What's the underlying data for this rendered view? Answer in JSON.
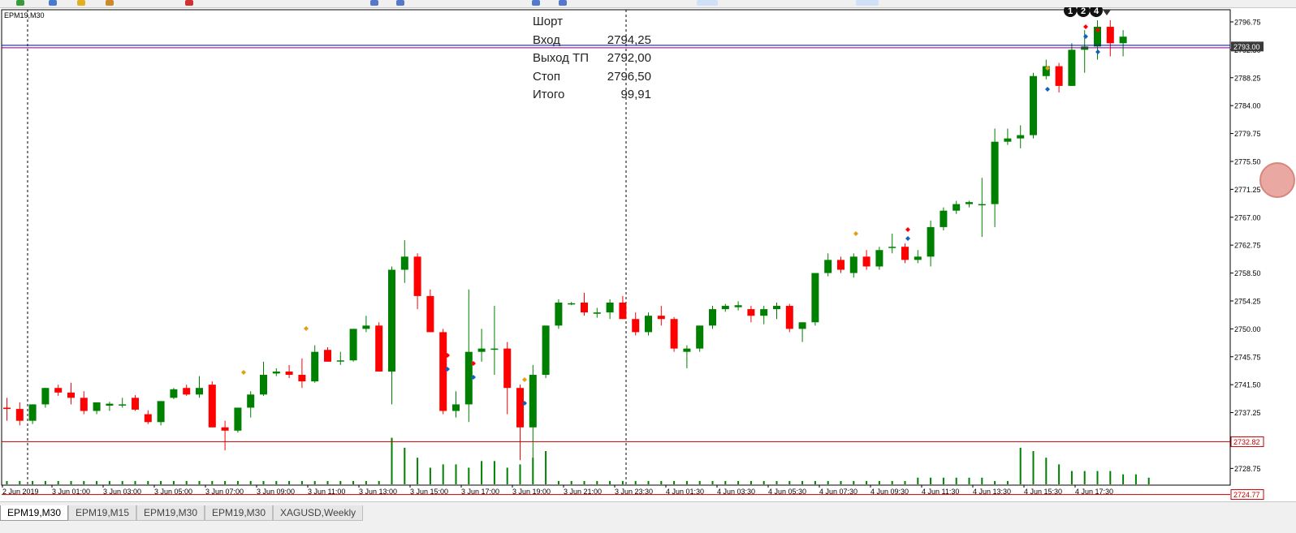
{
  "symbol_label": "EPM19,M30",
  "trade_info": {
    "rows": [
      {
        "label": "Шорт",
        "value": ""
      },
      {
        "label": "Вход",
        "value": "2794,25"
      },
      {
        "label": "Выход ТП",
        "value": "2792,00"
      },
      {
        "label": "Стоп",
        "value": "2796,50"
      },
      {
        "label": "Итого",
        "value": "99,91"
      }
    ]
  },
  "markers": [
    "1",
    "2",
    "4"
  ],
  "tabs": [
    {
      "label": "EPM19,M30",
      "active": true
    },
    {
      "label": "EPM19,M15",
      "active": false
    },
    {
      "label": "EPM19,M30",
      "active": false
    },
    {
      "label": "EPM19,M30",
      "active": false
    },
    {
      "label": "XAGUSD,Weekly",
      "active": false
    }
  ],
  "colors": {
    "bull": "#008000",
    "bear": "#ff0000",
    "grid_line": "#c00000",
    "price_line": "#0000c0",
    "price_line2": "#800080"
  },
  "chart_data": {
    "type": "candlestick",
    "ylim": [
      2726.2,
      2798.6
    ],
    "y_ticks": [
      "2796.75",
      "2792.50",
      "2788.25",
      "2784.00",
      "2779.75",
      "2775.50",
      "2771.25",
      "2767.00",
      "2762.75",
      "2758.50",
      "2754.25",
      "2750.00",
      "2745.75",
      "2741.50",
      "2737.25",
      "2733.00",
      "2728.75",
      "2724.50"
    ],
    "x_tick_labels": [
      "2 Jun 2019",
      "3 Jun 01:00",
      "3 Jun 03:00",
      "3 Jun 05:00",
      "3 Jun 07:00",
      "3 Jun 09:00",
      "3 Jun 11:00",
      "3 Jun 13:00",
      "3 Jun 15:00",
      "3 Jun 17:00",
      "3 Jun 19:00",
      "3 Jun 21:00",
      "3 Jun 23:30",
      "4 Jun 01:30",
      "4 Jun 03:30",
      "4 Jun 05:30",
      "4 Jun 07:30",
      "4 Jun 09:30",
      "4 Jun 11:30",
      "4 Jun 13:30",
      "4 Jun 15:30",
      "4 Jun 17:30"
    ],
    "price_tags": [
      {
        "price": 2793.0,
        "label": "2793.00",
        "kind": "current"
      },
      {
        "price": 2732.82,
        "label": "2732.82",
        "kind": "level"
      },
      {
        "price": 2724.77,
        "label": "2724.77",
        "kind": "level"
      }
    ],
    "candles": [
      [
        2738.0,
        2739.5,
        2736.0,
        2737.8
      ],
      [
        2737.8,
        2738.8,
        2735.3,
        2736.0
      ],
      [
        2736.0,
        2738.5,
        2735.5,
        2738.5
      ],
      [
        2738.5,
        2741.0,
        2738.0,
        2741.0
      ],
      [
        2741.0,
        2741.5,
        2739.8,
        2740.3
      ],
      [
        2740.3,
        2741.8,
        2738.5,
        2739.5
      ],
      [
        2739.5,
        2740.5,
        2737.0,
        2737.5
      ],
      [
        2737.5,
        2738.8,
        2737.0,
        2738.8
      ],
      [
        2738.3,
        2738.9,
        2737.5,
        2738.6
      ],
      [
        2738.5,
        2739.5,
        2738.0,
        2738.5
      ],
      [
        2739.5,
        2739.9,
        2737.5,
        2737.7
      ],
      [
        2737.0,
        2737.6,
        2735.5,
        2735.8
      ],
      [
        2735.8,
        2739.0,
        2735.3,
        2739.0
      ],
      [
        2739.5,
        2741.0,
        2739.3,
        2740.8
      ],
      [
        2741.0,
        2741.5,
        2739.8,
        2740.0
      ],
      [
        2740.0,
        2742.8,
        2739.5,
        2741.0
      ],
      [
        2741.5,
        2742.0,
        2735.0,
        2735.0
      ],
      [
        2735.0,
        2736.0,
        2731.5,
        2734.5
      ],
      [
        2734.5,
        2738.0,
        2734.2,
        2738.0
      ],
      [
        2738.0,
        2740.5,
        2736.5,
        2740.0
      ],
      [
        2740.0,
        2745.0,
        2739.8,
        2743.0
      ],
      [
        2743.2,
        2744.0,
        2742.8,
        2743.5
      ],
      [
        2743.5,
        2744.5,
        2742.5,
        2743.0
      ],
      [
        2743.0,
        2745.5,
        2741.0,
        2742.0
      ],
      [
        2742.0,
        2747.5,
        2741.8,
        2746.5
      ],
      [
        2746.8,
        2747.2,
        2745.0,
        2745.0
      ],
      [
        2745.2,
        2746.5,
        2744.5,
        2745.2
      ],
      [
        2745.2,
        2750.0,
        2745.0,
        2750.0
      ],
      [
        2750.0,
        2752.0,
        2749.5,
        2750.5
      ],
      [
        2750.5,
        2751.0,
        2743.5,
        2743.5
      ],
      [
        2743.5,
        2759.5,
        2738.5,
        2759.0
      ],
      [
        2759.0,
        2763.5,
        2757.0,
        2761.0
      ],
      [
        2761.0,
        2761.5,
        2753.0,
        2755.0
      ],
      [
        2755.0,
        2756.0,
        2749.5,
        2749.5
      ],
      [
        2749.5,
        2750.0,
        2737.0,
        2737.5
      ],
      [
        2737.5,
        2740.5,
        2736.5,
        2738.5
      ],
      [
        2738.5,
        2756.0,
        2735.8,
        2746.5
      ],
      [
        2746.5,
        2750.0,
        2745.0,
        2747.0
      ],
      [
        2747.0,
        2753.5,
        2743.0,
        2747.0
      ],
      [
        2747.0,
        2748.0,
        2737.0,
        2741.0
      ],
      [
        2741.0,
        2741.5,
        2730.0,
        2735.0
      ],
      [
        2735.0,
        2744.5,
        2730.0,
        2743.0
      ],
      [
        2743.0,
        2750.5,
        2742.5,
        2750.5
      ],
      [
        2750.5,
        2754.5,
        2750.0,
        2754.0
      ],
      [
        2753.8,
        2754.1,
        2753.6,
        2753.9
      ],
      [
        2754.0,
        2755.5,
        2752.0,
        2752.5
      ],
      [
        2752.3,
        2753.2,
        2751.7,
        2752.5
      ],
      [
        2752.5,
        2754.5,
        2751.5,
        2754.0
      ],
      [
        2754.0,
        2755.0,
        2751.5,
        2751.5
      ],
      [
        2751.5,
        2752.5,
        2749.0,
        2749.5
      ],
      [
        2749.5,
        2752.5,
        2749.0,
        2752.0
      ],
      [
        2752.0,
        2753.5,
        2750.5,
        2751.5
      ],
      [
        2751.5,
        2751.8,
        2746.5,
        2747.0
      ],
      [
        2746.5,
        2747.5,
        2744.0,
        2747.0
      ],
      [
        2747.0,
        2750.5,
        2746.5,
        2750.5
      ],
      [
        2750.5,
        2753.5,
        2750.0,
        2753.0
      ],
      [
        2753.0,
        2753.8,
        2752.6,
        2753.5
      ],
      [
        2753.3,
        2754.2,
        2752.8,
        2753.6
      ],
      [
        2753.0,
        2753.5,
        2751.0,
        2752.0
      ],
      [
        2752.0,
        2753.5,
        2750.7,
        2753.0
      ],
      [
        2753.0,
        2754.0,
        2751.5,
        2753.5
      ],
      [
        2753.5,
        2753.8,
        2749.5,
        2750.0
      ],
      [
        2750.0,
        2751.0,
        2748.0,
        2751.0
      ],
      [
        2751.0,
        2758.5,
        2750.5,
        2758.5
      ],
      [
        2758.5,
        2761.5,
        2758.0,
        2760.5
      ],
      [
        2760.5,
        2761.0,
        2758.5,
        2759.0
      ],
      [
        2758.5,
        2761.5,
        2757.8,
        2761.0
      ],
      [
        2761.0,
        2762.0,
        2759.0,
        2759.5
      ],
      [
        2759.5,
        2762.5,
        2759.0,
        2762.0
      ],
      [
        2762.5,
        2764.5,
        2761.5,
        2762.5
      ],
      [
        2762.5,
        2763.0,
        2760.0,
        2760.5
      ],
      [
        2760.5,
        2762.0,
        2760.0,
        2761.0
      ],
      [
        2761.0,
        2766.5,
        2759.5,
        2765.5
      ],
      [
        2765.5,
        2768.5,
        2765.0,
        2768.0
      ],
      [
        2768.0,
        2769.5,
        2767.5,
        2769.0
      ],
      [
        2769.0,
        2769.5,
        2768.5,
        2769.3
      ],
      [
        2769.0,
        2773.0,
        2764.0,
        2769.0
      ],
      [
        2769.0,
        2780.5,
        2765.5,
        2778.5
      ],
      [
        2778.5,
        2780.5,
        2778.0,
        2779.0
      ],
      [
        2779.0,
        2781.0,
        2777.5,
        2779.5
      ],
      [
        2779.5,
        2789.0,
        2779.0,
        2788.5
      ],
      [
        2788.5,
        2791.0,
        2788.0,
        2790.0
      ],
      [
        2790.0,
        2790.5,
        2786.0,
        2787.0
      ],
      [
        2787.0,
        2793.5,
        2787.0,
        2792.5
      ],
      [
        2792.5,
        2795.5,
        2789.0,
        2793.0
      ],
      [
        2793.0,
        2797.0,
        2791.0,
        2796.0
      ],
      [
        2796.0,
        2797.0,
        2791.5,
        2793.5
      ],
      [
        2793.5,
        2795.5,
        2791.5,
        2794.5
      ]
    ],
    "volumes": [
      1,
      1,
      1,
      1,
      1,
      1,
      1,
      1,
      1,
      1,
      1,
      1,
      1,
      1,
      1,
      1,
      1,
      1,
      1,
      1,
      1,
      1,
      1,
      1,
      1,
      1,
      1,
      1,
      1,
      1,
      14,
      11,
      8,
      5,
      6,
      6,
      5,
      7,
      7,
      5,
      6,
      8,
      10,
      1,
      1,
      1,
      1,
      1,
      1,
      1,
      1,
      1,
      1,
      1,
      1,
      1,
      1,
      1,
      1,
      1,
      1,
      1,
      1,
      1,
      1,
      1,
      1,
      1,
      1,
      1,
      1,
      2,
      2,
      2,
      2,
      2,
      2,
      1,
      1,
      11,
      10,
      8,
      6,
      4,
      4,
      4,
      4,
      3,
      3,
      2
    ]
  }
}
